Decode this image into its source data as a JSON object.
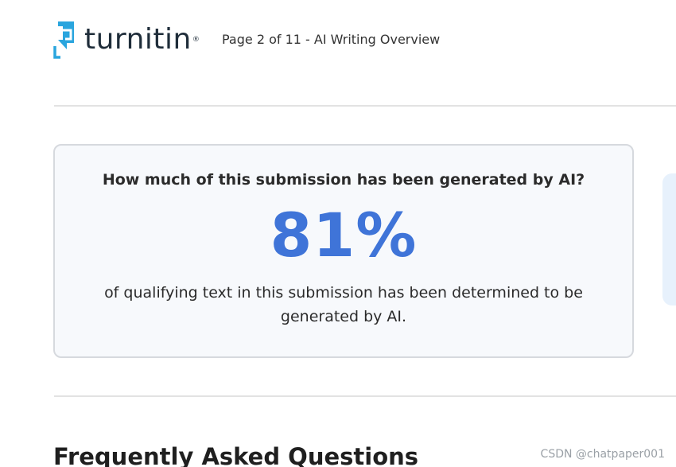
{
  "header": {
    "logo_text": "turnitin",
    "logo_mark": "®",
    "page_info": "Page 2 of 11 - AI Writing Overview"
  },
  "ai_card": {
    "question": "How much of this submission has been generated by AI?",
    "percentage": "81%",
    "description": "of qualifying text in this submission has been determined to be generated by AI."
  },
  "faq": {
    "heading": "Frequently Asked Questions"
  },
  "watermark": "CSDN @chatpaper001",
  "colors": {
    "accent": "#3f74d8",
    "logo_blue": "#2aa5de",
    "card_bg": "#f7f9fc",
    "card_border": "#d6d9de",
    "side_panel_bg": "#e7f1fc"
  },
  "icons": {
    "logo": "turnitin-logo-icon"
  }
}
